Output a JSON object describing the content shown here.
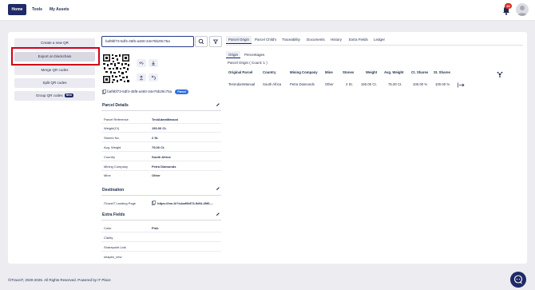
{
  "nav": {
    "home": "Home",
    "tools": "Tools",
    "assets": "My Assets",
    "notification_count": "26"
  },
  "menu": {
    "create_qr": "Create a new QR",
    "export_blockchain": "Export on blockchain",
    "merge_qr": "Merge QR codes",
    "split_qr": "Split QR codes",
    "group_qr": "Group QR codes",
    "new_badge": "New"
  },
  "search": {
    "value": "baf9bf73-5df4-45f6-a460-34e76b29c75a"
  },
  "qr": {
    "id": "baf9bf73-5df4-45f6-a460-34e76b29c75a",
    "badge": "Parcel"
  },
  "parcel_details": {
    "title": "Parcel Details",
    "rows": [
      {
        "label": "Parcel Reference",
        "value": "TestAdamManual"
      },
      {
        "label": "Weight(Ct)",
        "value": "150.00 Ct."
      },
      {
        "label": "Stones No.",
        "value": "2 St."
      },
      {
        "label": "Avg. Weight",
        "value": "75.00 Ct."
      },
      {
        "label": "Country",
        "value": "South Africa"
      },
      {
        "label": "Mining Company",
        "value": "Petra Diamonds"
      },
      {
        "label": "Mine",
        "value": "Other"
      }
    ]
  },
  "destination": {
    "title": "Destination",
    "label": "iTraceiT Landing Page",
    "value": "https://lnn.it/?t=baf9bf73-5df4-45f6-..."
  },
  "extra_fields": {
    "title": "Extra Fields",
    "rows": [
      {
        "label": "Color",
        "value": "Pink"
      },
      {
        "label": "Clarity",
        "value": ""
      },
      {
        "label": "Sharepoint Link",
        "value": ""
      },
      {
        "label": "shapes_new",
        "value": ""
      }
    ]
  },
  "tabs": [
    "Parcel Origin",
    "Parcel Child's",
    "Traceability",
    "Documents",
    "History",
    "Extra Fields",
    "Ledger"
  ],
  "subtabs": [
    "Origin",
    "Percentages"
  ],
  "origin_count": "Parcel Origin ( Count: 1 )",
  "table": {
    "headers": [
      "Original Parcel",
      "Country",
      "Mining Company",
      "Mine",
      "Stones",
      "Weight",
      "Avg. Weight",
      "Ct. Shares",
      "St. Shares"
    ],
    "rows": [
      [
        "TestAdamManual",
        "South Africa",
        "Petra Diamonds",
        "Other",
        "2 St.",
        "150.00 Ct.",
        "75.00 Ct.",
        "100.00 %",
        "100.00 %"
      ]
    ]
  },
  "footer": "©iTraceiT, 2020-2025. All Rights Reserved. Powered by IT Place",
  "colors": {
    "brand": "#1f2a66",
    "highlight": "#d0021b",
    "badge": "#2f6fe0"
  }
}
